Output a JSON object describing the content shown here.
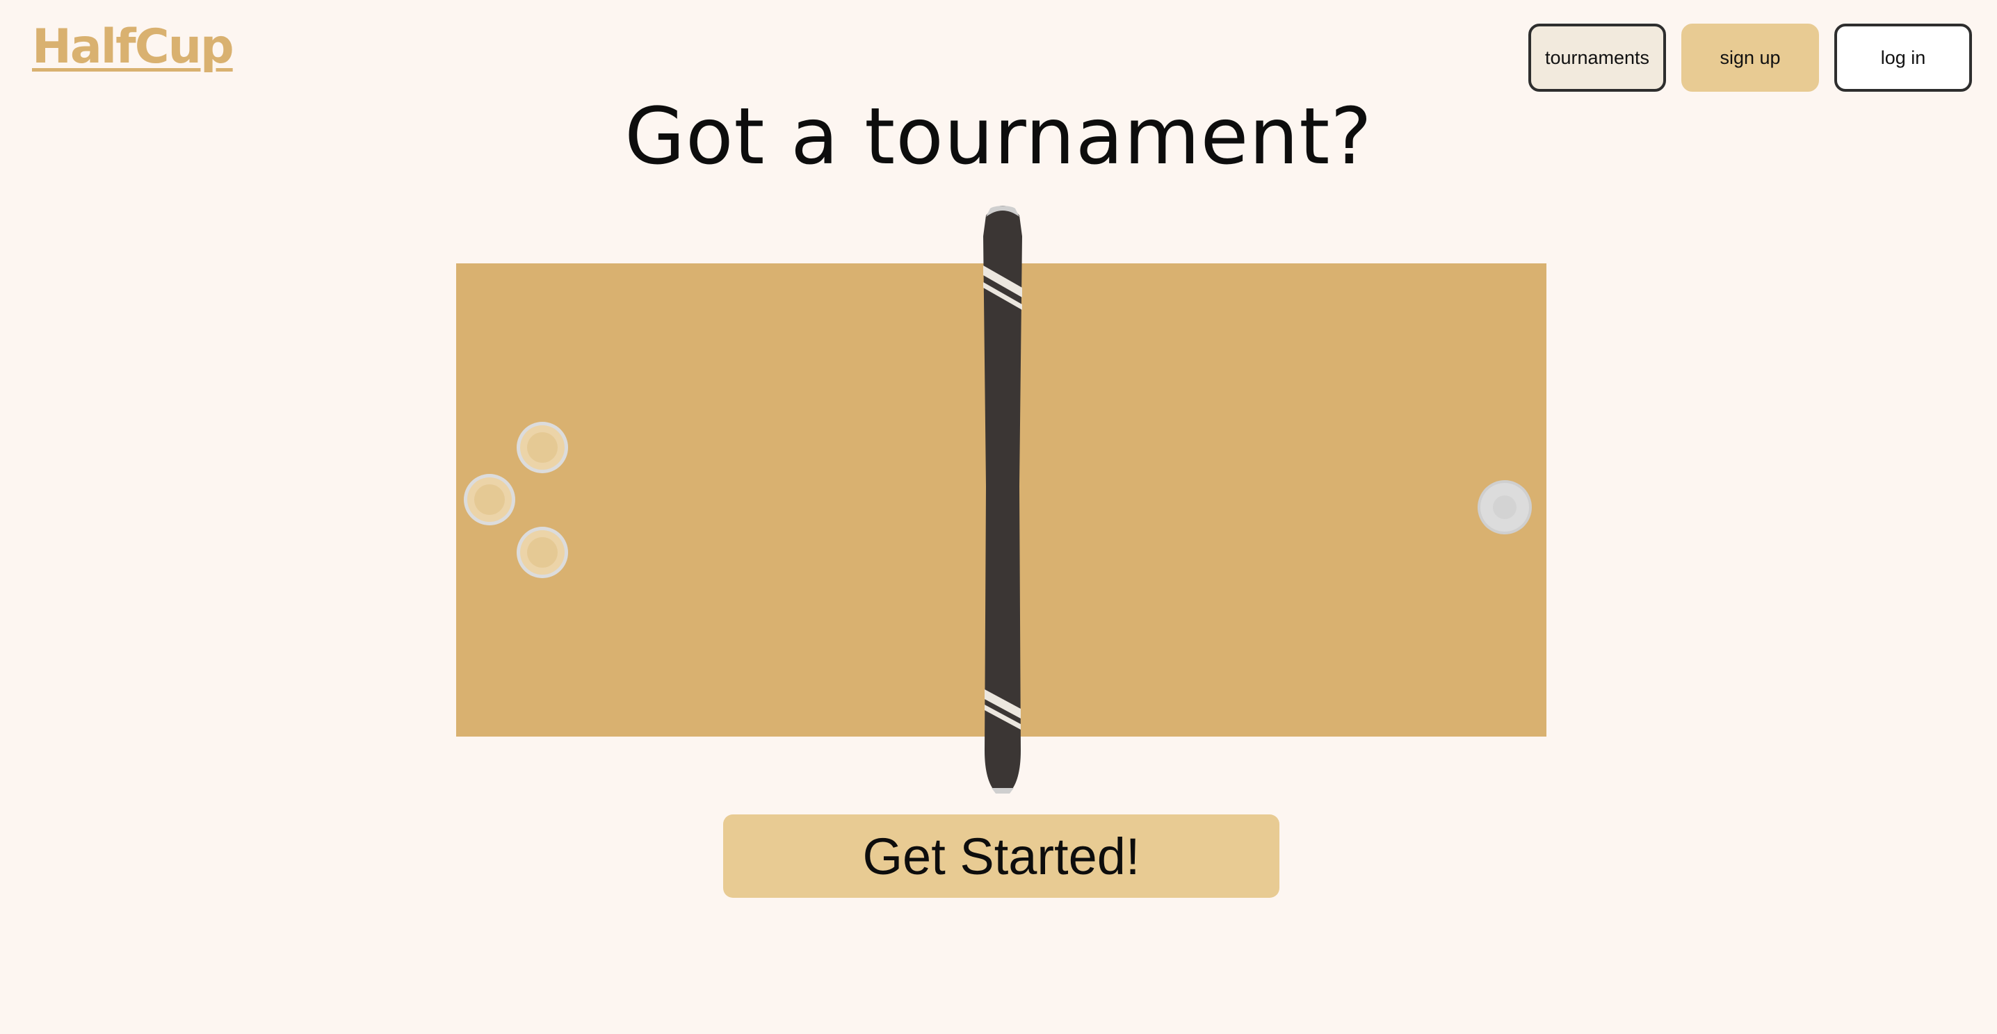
{
  "header": {
    "logo_text": "HalfCup",
    "nav": {
      "tournaments_label": "tournaments",
      "signup_label": "sign up",
      "login_label": "log in"
    }
  },
  "hero": {
    "headline": "Got a tournament?",
    "cta_label": "Get Started!"
  },
  "colors": {
    "background": "#fdf6f1",
    "brand_gold": "#d9b170",
    "button_gold": "#e8cb93",
    "table_wood": "#d9b170",
    "divider_stick": "#3b3634"
  },
  "icons": {
    "illustration": "halfcup-table-illustration",
    "cups": "cup-icon"
  }
}
